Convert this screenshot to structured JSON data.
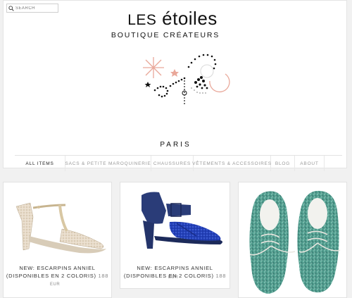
{
  "search": {
    "placeholder": "SEARCH"
  },
  "brand": {
    "logo_prefix": "LES",
    "logo_name": "étoiles",
    "subtitle": "BOUTIQUE CRÉATEURS",
    "city": "PARIS"
  },
  "nav": {
    "items": [
      {
        "label": "ALL ITEMS",
        "active": true
      },
      {
        "label": "SACS & PETITE MAROQUINERIE",
        "active": false
      },
      {
        "label": "CHAUSSURES",
        "active": false
      },
      {
        "label": "VÊTEMENTS & ACCESSOIRES",
        "active": false
      },
      {
        "label": "BLOG",
        "active": false
      },
      {
        "label": "ABOUT",
        "active": false
      }
    ]
  },
  "products": [
    {
      "title_line1": "NEW: ESCARPINS ANNIEL",
      "title_line2": "(DISPONIBLES EN 2 COLORIS)",
      "price": "188",
      "currency": "EUR",
      "image": "gold-glitter-t-strap-heel"
    },
    {
      "title_line1": "NEW: ESCARPINS ANNIEL",
      "title_line2": "(DISPONIBLES EN 2 COLORIS)",
      "price": "188",
      "currency": "EUR",
      "image": "navy-blue-glitter-heel"
    },
    {
      "image": "green-glitter-lace-up-shoes"
    }
  ]
}
